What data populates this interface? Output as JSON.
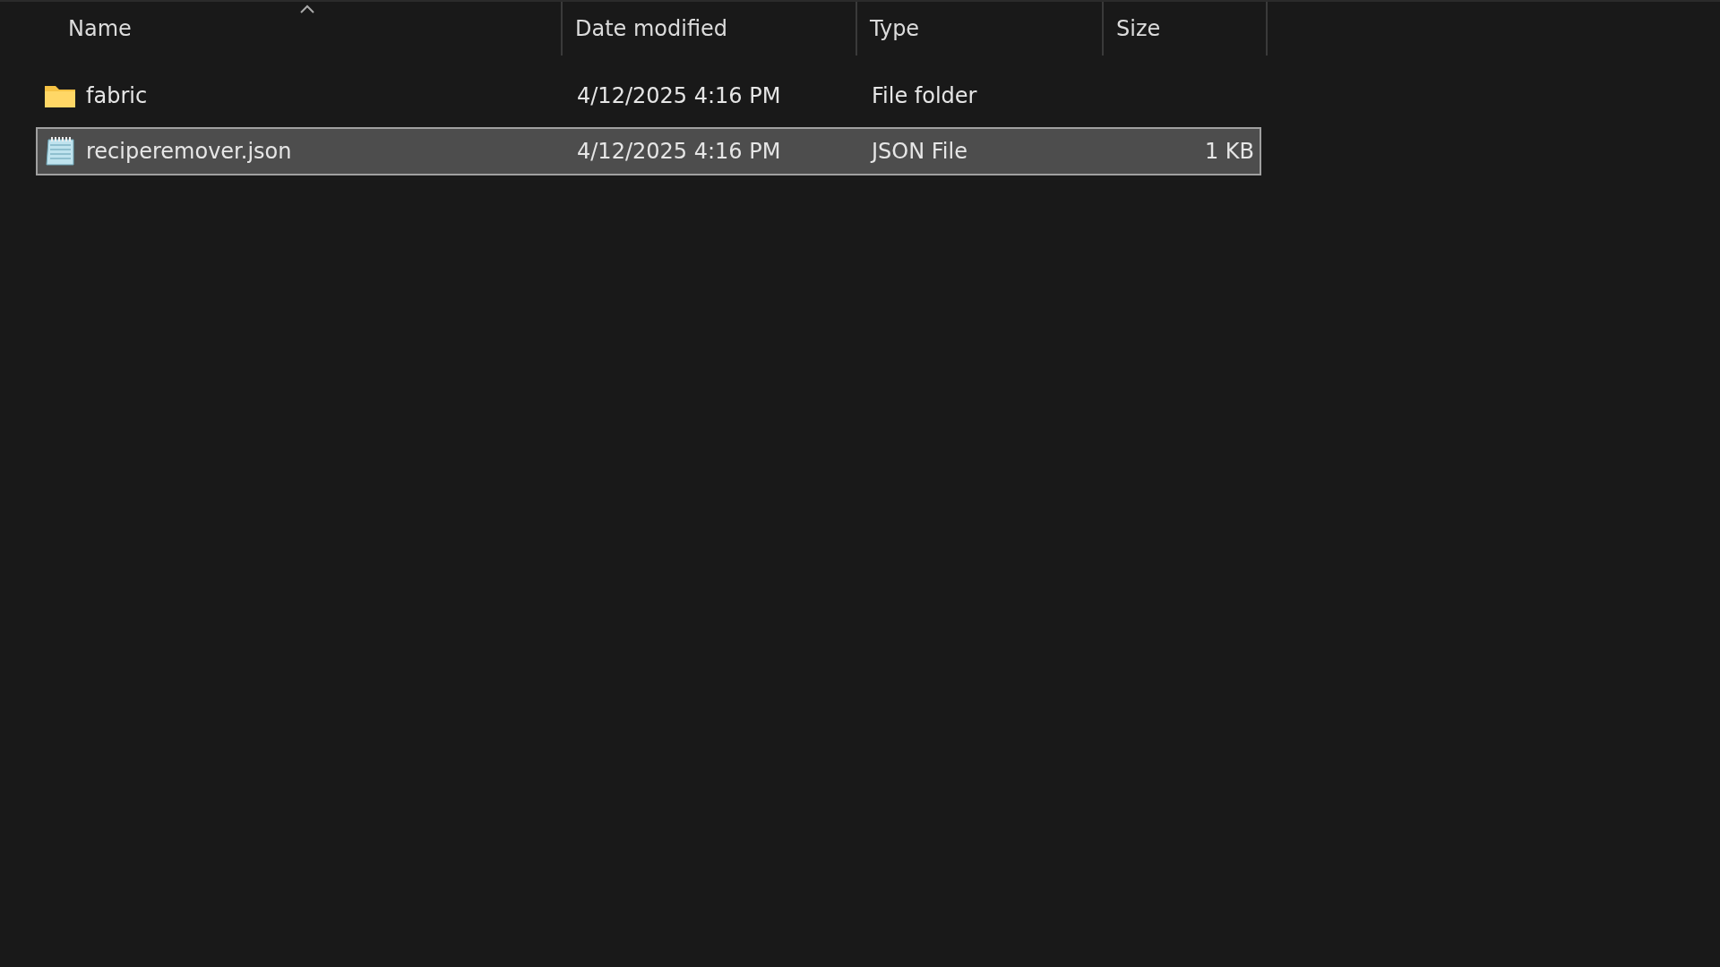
{
  "columns": [
    {
      "label": "Name",
      "sorted": true
    },
    {
      "label": "Date modified",
      "sorted": false
    },
    {
      "label": "Type",
      "sorted": false
    },
    {
      "label": "Size",
      "sorted": false
    }
  ],
  "rows": [
    {
      "kind": "folder",
      "name": "fabric",
      "date_modified": "4/12/2025 4:16 PM",
      "type": "File folder",
      "selected": false
    },
    {
      "kind": "file",
      "name": "reciperemover.json",
      "date_modified": "4/12/2025 4:16 PM",
      "type": "JSON File",
      "size": "1 KB",
      "selected": true
    }
  ]
}
